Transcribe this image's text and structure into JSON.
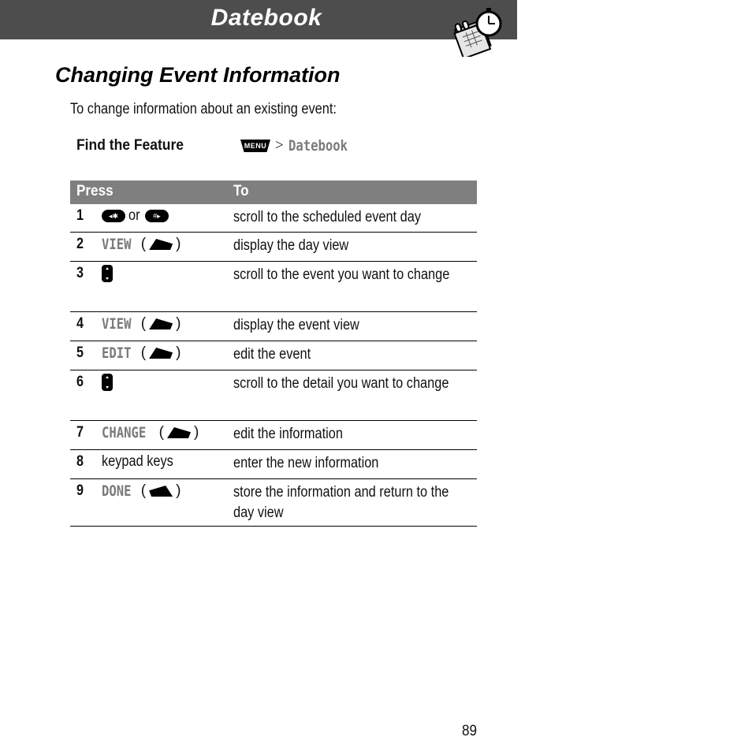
{
  "header": {
    "title": "Datebook",
    "icon": "datebook-calendar-stopwatch-icon"
  },
  "section": {
    "title": "Changing Event Information",
    "intro": "To change information about an existing event:"
  },
  "find_feature": {
    "label": "Find the Feature",
    "menu_key": "MENU",
    "separator": ">",
    "path": "Datebook"
  },
  "table": {
    "headers": {
      "press": "Press",
      "to": "To"
    },
    "rows": [
      {
        "num": "1",
        "press_parts": [
          {
            "type": "key",
            "icon": "left-star-nav-key",
            "glyph": "◂✱"
          },
          {
            "type": "text",
            "text": "or"
          },
          {
            "type": "key",
            "icon": "hash-right-nav-key",
            "glyph": "#▸"
          }
        ],
        "to": "scroll to the scheduled event day"
      },
      {
        "num": "2",
        "softkey": "VIEW",
        "key_icon": "right-soft-key",
        "to": "display the day view"
      },
      {
        "num": "3",
        "key_icon": "up-down-nav-key",
        "to": "scroll to the event you want to change"
      },
      {
        "num": "4",
        "softkey": "VIEW",
        "key_icon": "right-soft-key",
        "to": "display the event view"
      },
      {
        "num": "5",
        "softkey": "EDIT",
        "key_icon": "right-soft-key",
        "to": "edit the event"
      },
      {
        "num": "6",
        "key_icon": "up-down-nav-key",
        "to": "scroll to the detail you want to change"
      },
      {
        "num": "7",
        "softkey": "CHANGE",
        "key_icon": "right-soft-key",
        "to": "edit the information"
      },
      {
        "num": "8",
        "press_text": "keypad keys",
        "to": "enter the new information"
      },
      {
        "num": "9",
        "softkey": "DONE",
        "key_icon": "left-soft-key",
        "to": "store the information and return to the day view"
      }
    ]
  },
  "page_number": "89",
  "colors": {
    "header_bg": "#4d4d4d",
    "table_header_bg": "#7f7f7f",
    "softkey_text": "#7a7a7a"
  }
}
